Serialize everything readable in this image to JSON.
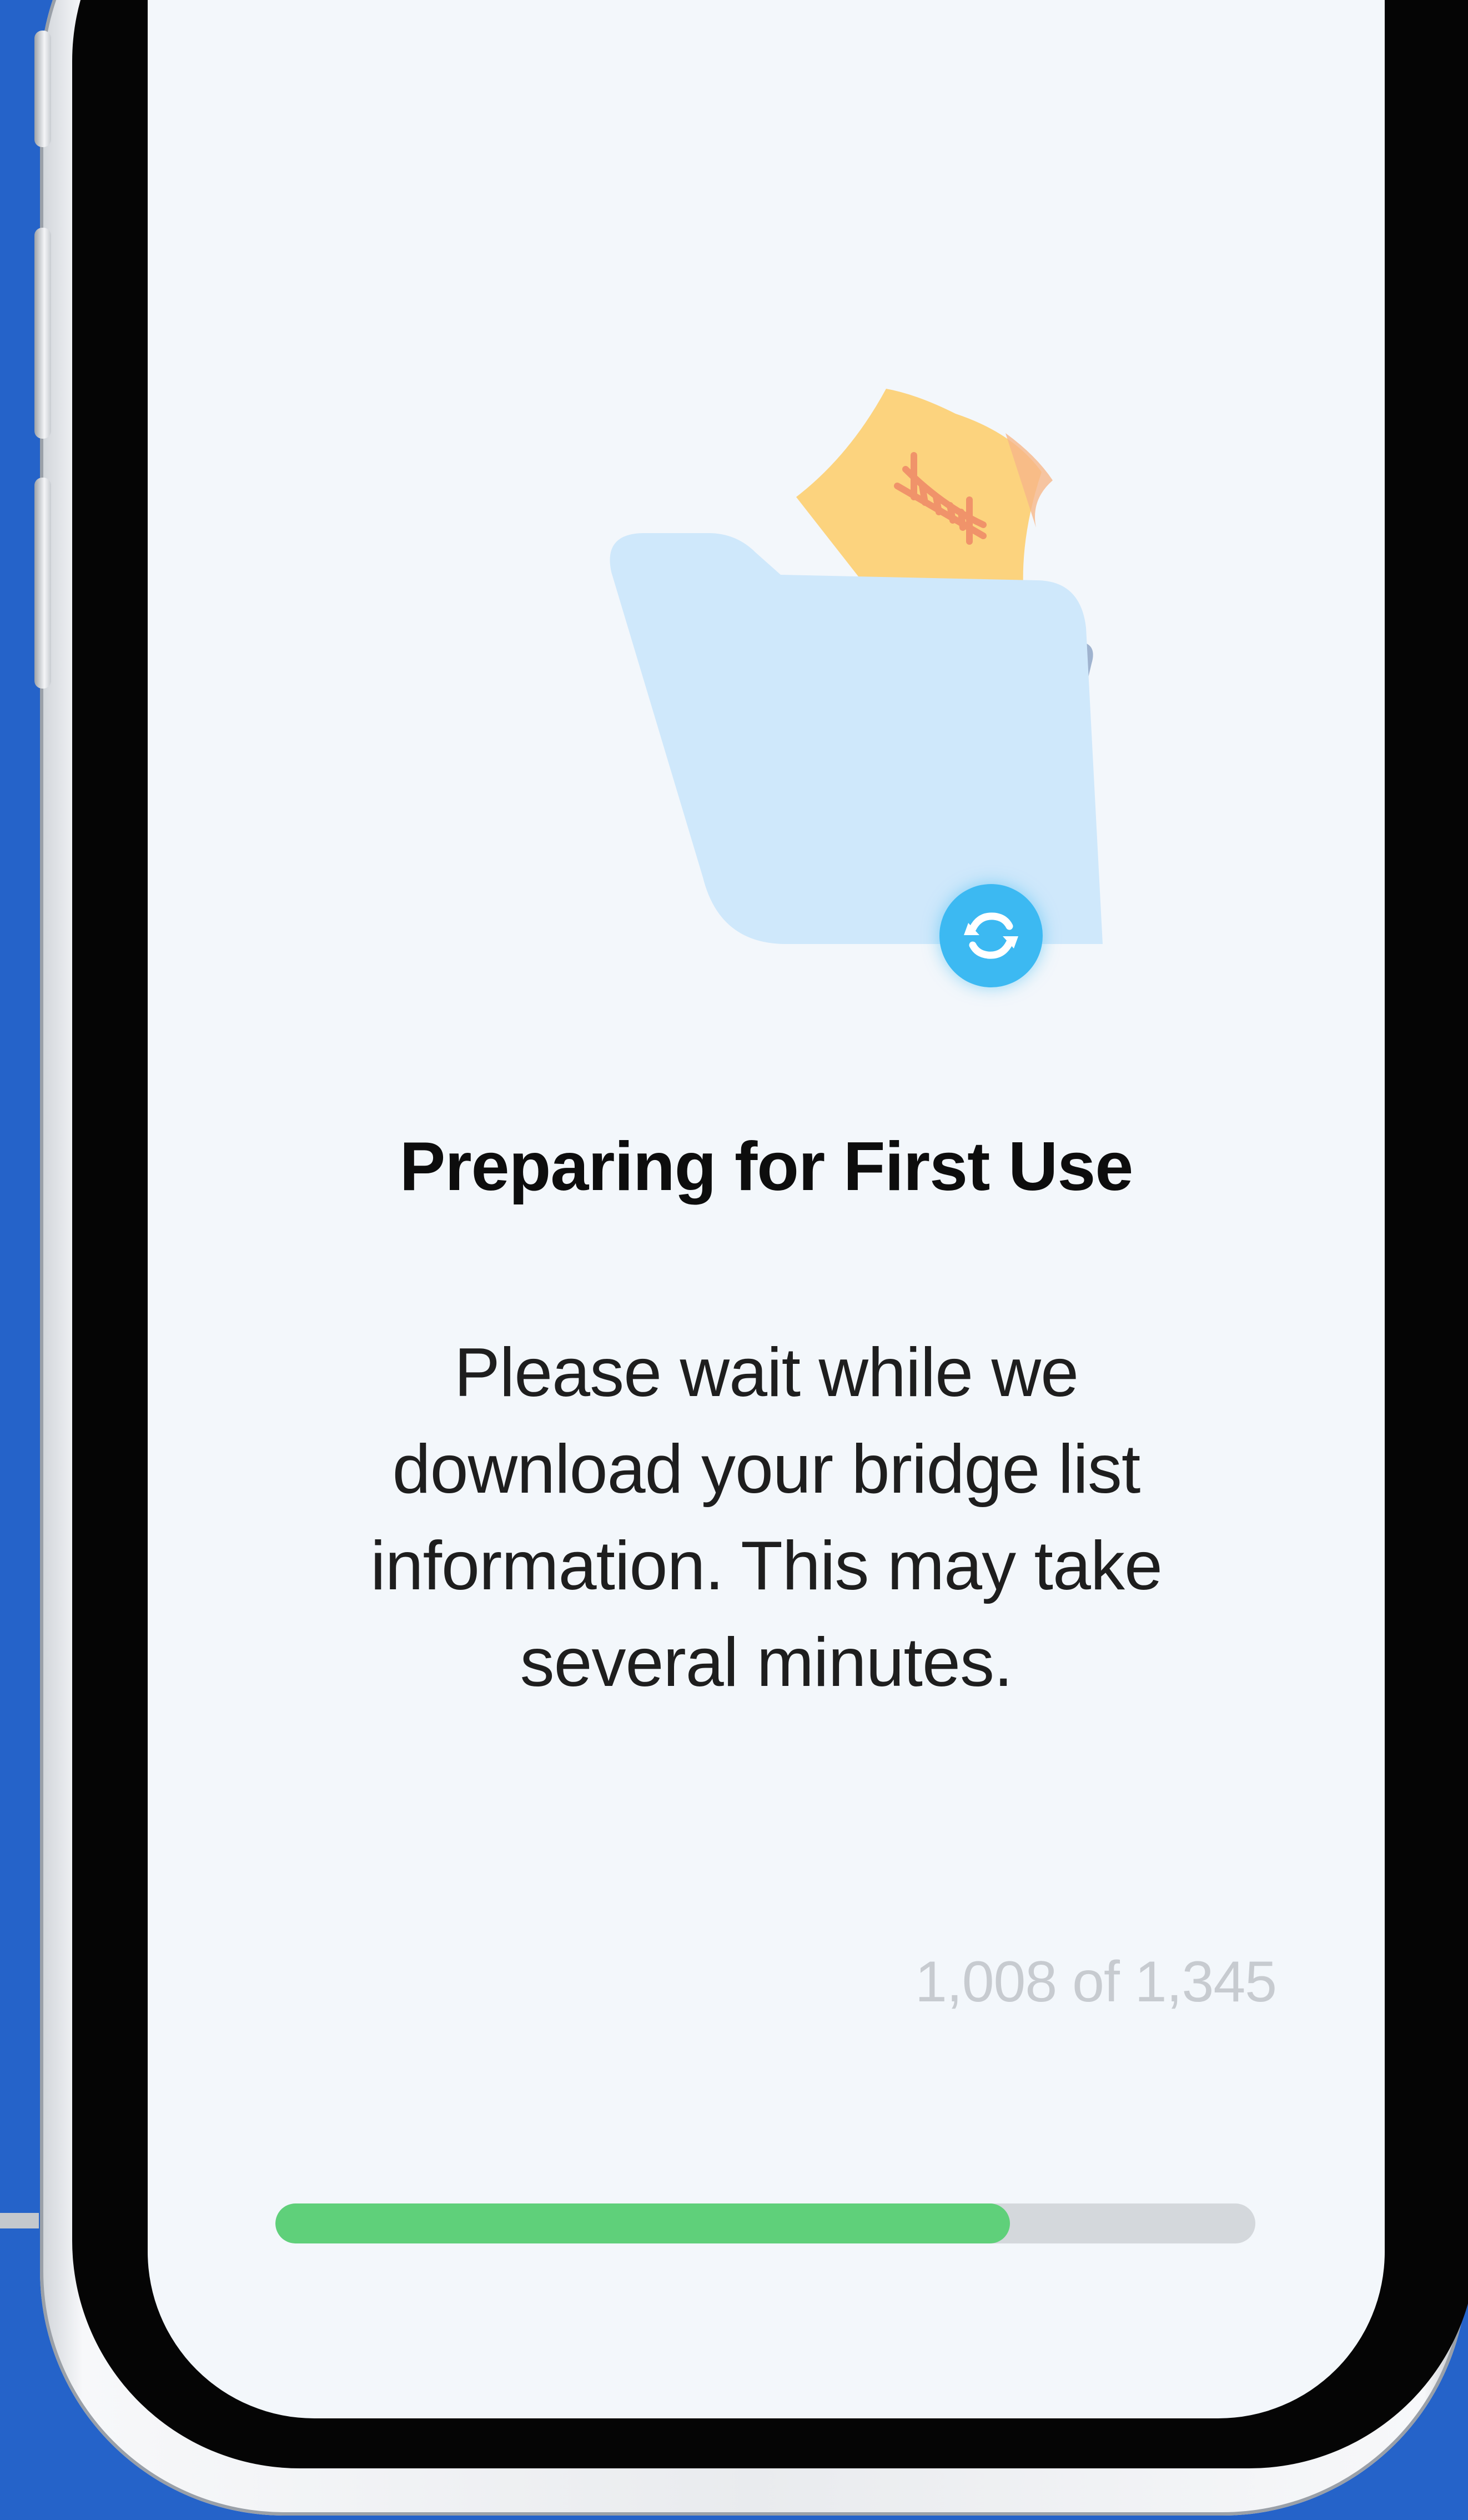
{
  "screen": {
    "title": "Preparing for First Use",
    "message": "Please wait while we download your bridge list information. This may take several minutes."
  },
  "progress": {
    "label": "1,008 of 1,345",
    "current": 1008,
    "total": 1345,
    "fraction": 0.7494
  },
  "illustration": {
    "folder_icon": "folder-icon",
    "document_icon": "bridge-document-icon",
    "sync_icon": "sync-icon"
  },
  "colors": {
    "background": "#2563c9",
    "screen": "#f3f7fb",
    "folder_front": "#cfe8fb",
    "folder_back": "#9fb3cf",
    "document": "#fcd37e",
    "bridge_drawing": "#f0936a",
    "sync_badge": "#3cb9f2",
    "progress_fill": "#5fd07a",
    "progress_track": "#d4d8dc",
    "progress_text": "#c7cbd0"
  }
}
